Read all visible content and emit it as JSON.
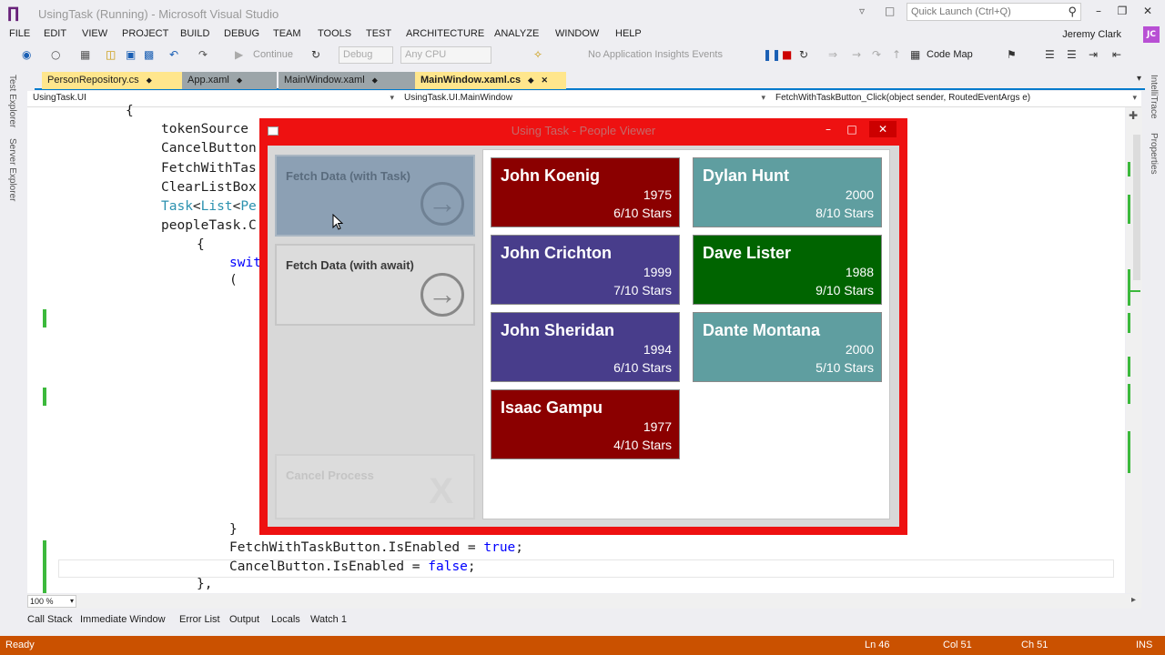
{
  "titlebar": {
    "title": "UsingTask (Running) - Microsoft Visual Studio",
    "quick_launch_placeholder": "Quick Launch (Ctrl+Q)",
    "vs_logo": "visual-studio-logo"
  },
  "menu": {
    "items": [
      "FILE",
      "EDIT",
      "VIEW",
      "PROJECT",
      "BUILD",
      "DEBUG",
      "TEAM",
      "TOOLS",
      "TEST",
      "ARCHITECTURE",
      "ANALYZE",
      "WINDOW",
      "HELP"
    ],
    "user": "Jeremy Clark",
    "avatar_initials": "JC"
  },
  "toolbar": {
    "continue_label": "Continue",
    "config": "Debug",
    "platform": "Any CPU",
    "insights": "No Application Insights Events",
    "codemap": "Code Map"
  },
  "left_rail": {
    "tab1": "Test Explorer",
    "tab2": "Server Explorer"
  },
  "right_rail": {
    "tab1": "IntelliTrace",
    "tab2": "Properties"
  },
  "doc_tabs": [
    {
      "label": "PersonRepository.cs",
      "pin": "⬥"
    },
    {
      "label": "App.xaml",
      "pin": "⬥"
    },
    {
      "label": "MainWindow.xaml",
      "pin": "⬥"
    },
    {
      "label": "MainWindow.xaml.cs",
      "pin": "⬥"
    }
  ],
  "navbar": {
    "project": "UsingTask.UI",
    "class": "UsingTask.UI.MainWindow",
    "member": "FetchWithTaskButton_Click(object sender, RoutedEventArgs e)"
  },
  "code": {
    "l0": "{",
    "l1": "tokenSource",
    "l2": "CancelButton",
    "l3": "FetchWithTas",
    "l4": "ClearListBox",
    "l5a": "Task",
    "l5b": "<",
    "l5c": "List",
    "l5d": "<",
    "l5e": "Pe",
    "l6": "peopleTask.C",
    "l7": "{",
    "l8": "swit",
    "l9": "(",
    "l10": "}",
    "l11a": "FetchWithTaskButton.IsEnabled = ",
    "l11b": "true",
    "l11c": ";",
    "l12a": "CancelButton.IsEnabled = ",
    "l12b": "false",
    "l12c": ";",
    "l13": "},"
  },
  "zoom": "100 %",
  "bottom_tabs": [
    "Call Stack",
    "Immediate Window",
    "Error List",
    "Output",
    "Locals",
    "Watch 1"
  ],
  "status": {
    "ready": "Ready",
    "ln": "Ln 46",
    "col": "Col 51",
    "ch": "Ch 51",
    "ins": "INS"
  },
  "app": {
    "title": "Using Task - People Viewer",
    "buttons": {
      "fetch_task": "Fetch Data (with Task)",
      "fetch_await": "Fetch Data (with await)",
      "cancel": "Cancel Process",
      "cancel_glyph": "X"
    },
    "people": [
      {
        "name": "John Koenig",
        "year": "1975",
        "rating": "6/10 Stars",
        "color": "#8b0000"
      },
      {
        "name": "Dylan Hunt",
        "year": "2000",
        "rating": "8/10 Stars",
        "color": "#5f9ea0"
      },
      {
        "name": "John Crichton",
        "year": "1999",
        "rating": "7/10 Stars",
        "color": "#483d8b"
      },
      {
        "name": "Dave Lister",
        "year": "1988",
        "rating": "9/10 Stars",
        "color": "#006400"
      },
      {
        "name": "John Sheridan",
        "year": "1994",
        "rating": "6/10 Stars",
        "color": "#483d8b"
      },
      {
        "name": "Dante Montana",
        "year": "2000",
        "rating": "5/10 Stars",
        "color": "#5f9ea0"
      },
      {
        "name": "Isaac Gampu",
        "year": "1977",
        "rating": "4/10 Stars",
        "color": "#8b0000"
      }
    ]
  },
  "colors": {
    "status_bar": "#ca5100",
    "app_frame": "#ee1111",
    "accent": "#007acc"
  }
}
